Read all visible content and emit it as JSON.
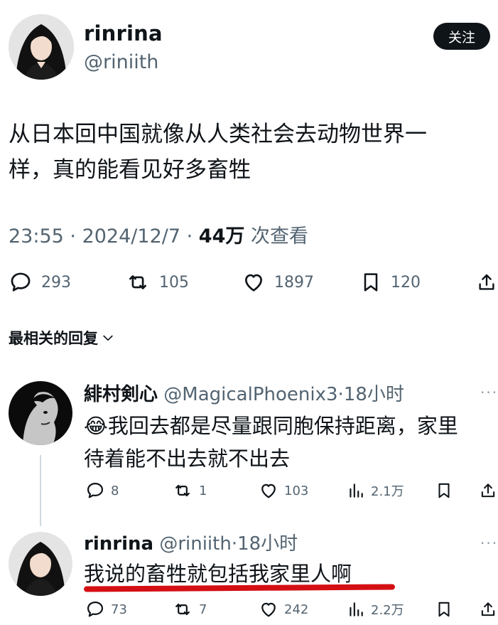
{
  "tweet": {
    "display_name": "rinrina",
    "handle": "@riniith",
    "follow_label": "关注",
    "text_line1": "从日本回中国就像从人类社会去动物世界一",
    "text_line2": "样，真的能看见好多畜牲",
    "time": "23:55",
    "date": "2024/12/7",
    "views_count": "44万",
    "views_label": "次查看",
    "stats": {
      "replies": "293",
      "retweets": "105",
      "likes": "1897",
      "bookmarks": "120"
    }
  },
  "replies_section": {
    "sort_label": "最相关的回复"
  },
  "replies": [
    {
      "display_name": "緋村剣心",
      "handle": "@MagicalPhoenix3",
      "age": "18小时",
      "emoji": "😂",
      "text_line1": "我回去都是尽量跟同胞保持距离，家里",
      "text_line2": "待着能不出去就不出去",
      "stats": {
        "replies": "8",
        "retweets": "1",
        "likes": "103",
        "views": "2.1万"
      }
    },
    {
      "display_name": "rinrina",
      "handle": "@riniith",
      "age": "18小时",
      "text_line1": "我说的畜牲就包括我家里人啊",
      "stats": {
        "replies": "73",
        "retweets": "7",
        "likes": "242",
        "views": "2.2万"
      }
    }
  ],
  "colors": {
    "text": "#0f1419",
    "muted": "#536471",
    "underline": "#d40f14"
  }
}
